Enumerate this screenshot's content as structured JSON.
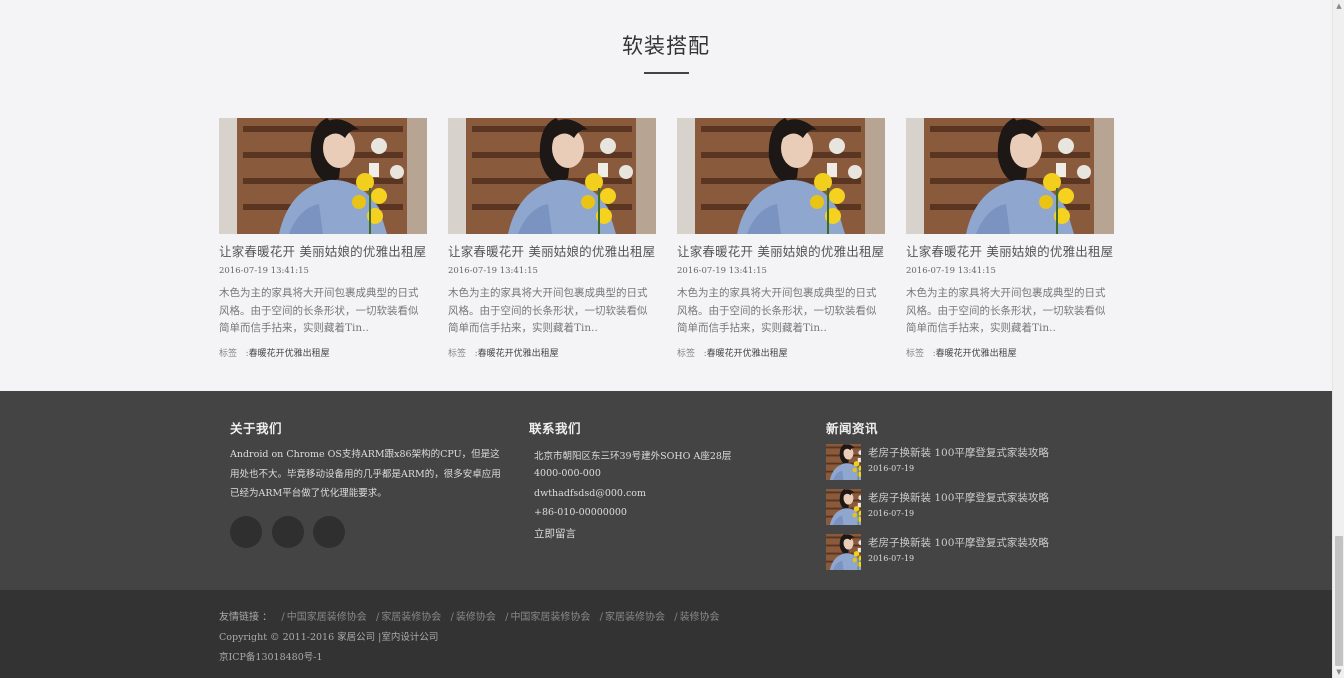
{
  "soft_section": {
    "title": "软装搭配",
    "cards": [
      {
        "title": "让家春暖花开 美丽姑娘的优雅出租屋",
        "date": "2016-07-19 13:41:15",
        "desc": "木色为主的家具将大开间包裹成典型的日式风格。由于空间的长条形状，一切软装看似简单而信手拈来，实则藏着Tin..",
        "tag_label": "标签",
        "tag": "春暖花开优雅出租屋"
      },
      {
        "title": "让家春暖花开 美丽姑娘的优雅出租屋",
        "date": "2016-07-19 13:41:15",
        "desc": "木色为主的家具将大开间包裹成典型的日式风格。由于空间的长条形状，一切软装看似简单而信手拈来，实则藏着Tin..",
        "tag_label": "标签",
        "tag": "春暖花开优雅出租屋"
      },
      {
        "title": "让家春暖花开 美丽姑娘的优雅出租屋",
        "date": "2016-07-19 13:41:15",
        "desc": "木色为主的家具将大开间包裹成典型的日式风格。由于空间的长条形状，一切软装看似简单而信手拈来，实则藏着Tin..",
        "tag_label": "标签",
        "tag": "春暖花开优雅出租屋"
      },
      {
        "title": "让家春暖花开 美丽姑娘的优雅出租屋",
        "date": "2016-07-19 13:41:15",
        "desc": "木色为主的家具将大开间包裹成典型的日式风格。由于空间的长条形状，一切软装看似简单而信手拈来，实则藏着Tin..",
        "tag_label": "标签",
        "tag": "春暖花开优雅出租屋"
      }
    ]
  },
  "footer": {
    "about": {
      "title": "关于我们",
      "text": "Android on Chrome OS支持ARM跟x86架构的CPU，但是这用处也不大。毕竟移动设备用的几乎都是ARM的，很多安卓应用已经为ARM平台做了优化理能要求。"
    },
    "contact": {
      "title": "联系我们",
      "address": "北京市朝阳区东三环39号建外SOHO A座28层",
      "phone": "4000-000-000",
      "email": "dwthadfsdsd@000.com",
      "tel": "+86-010-00000000",
      "message": "立即留言"
    },
    "news": {
      "title": "新闻资讯",
      "items": [
        {
          "title": "老房子换新装 100平摩登复式家装攻略",
          "date": "2016-07-19"
        },
        {
          "title": "老房子换新装 100平摩登复式家装攻略",
          "date": "2016-07-19"
        },
        {
          "title": "老房子换新装 100平摩登复式家装攻略",
          "date": "2016-07-19"
        }
      ]
    }
  },
  "bottom": {
    "links_label": "友情链接 ：",
    "links": [
      "中国家居装修协会",
      "家居装修协会",
      "装修协会",
      "中国家居装修协会",
      "家居装修协会",
      "装修协会"
    ],
    "copyright": "Copyright © 2011-2016 家居公司 |室内设计公司",
    "icp": "京ICP备13018480号-1"
  },
  "colors": {
    "footer_bg": "#444444",
    "bottom_bg": "#333333",
    "page_bg": "#f4f4f6"
  }
}
